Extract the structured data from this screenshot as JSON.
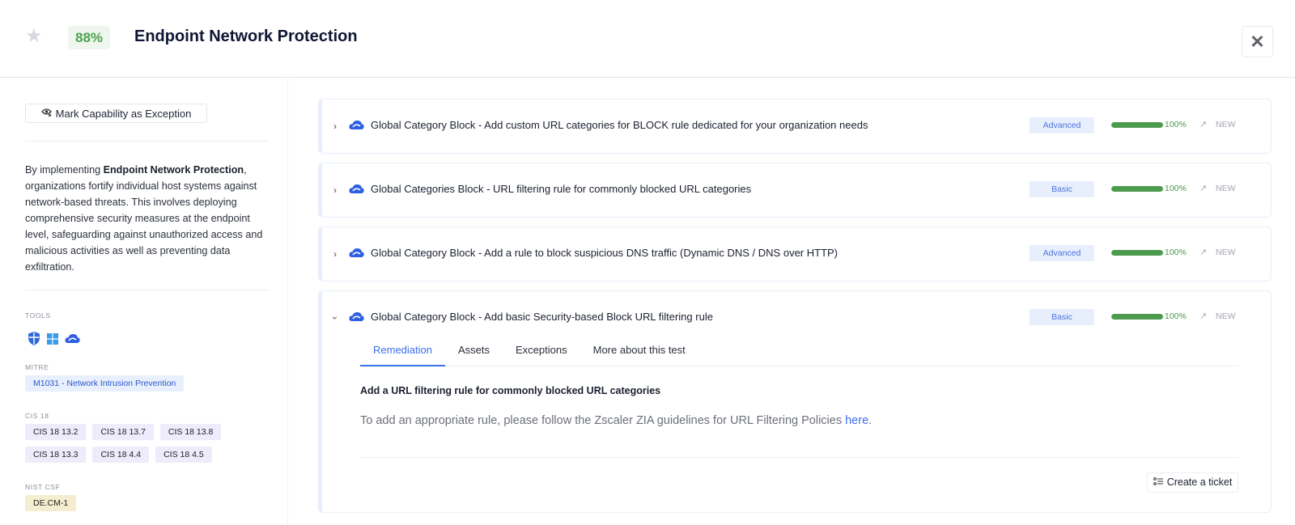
{
  "header": {
    "star_icon": "star-icon",
    "score": "88%",
    "title": "Endpoint Network Protection",
    "close_icon": "close-icon"
  },
  "left": {
    "exception_button": "Mark Capability as Exception",
    "description_prefix": "By implementing ",
    "description_bold": "Endpoint Network Protection",
    "description_suffix": ", organizations fortify individual host systems against network-based threats. This involves deploying comprehensive security measures at the endpoint level, safeguarding against unauthorized access and malicious activities as well as preventing data exfiltration.",
    "tools_label": "TOOLS",
    "tools": [
      "shield-defender-icon",
      "windows-icon",
      "zscaler-cloud-icon"
    ],
    "mitre_label": "MITRE",
    "mitre": [
      "M1031 - Network Intrusion Prevention"
    ],
    "cis_label": "CIS 18",
    "cis_rows": [
      [
        "CIS 18 13.2",
        "CIS 18 13.7",
        "CIS 18 13.8"
      ],
      [
        "CIS 18 13.3",
        "CIS 18 4.4",
        "CIS 18 4.5"
      ]
    ],
    "nist_label": "NIST CSF",
    "nist": [
      "DE.CM-1"
    ]
  },
  "cards": [
    {
      "title": "Global Category Block - Add custom URL categories for BLOCK rule dedicated for your organization needs",
      "level": "Advanced",
      "progress_pct": 100,
      "progress_label": "100%",
      "status": "NEW",
      "expanded": false
    },
    {
      "title": "Global Categories Block - URL filtering rule for commonly blocked URL categories",
      "level": "Basic",
      "progress_pct": 100,
      "progress_label": "100%",
      "status": "NEW",
      "expanded": false
    },
    {
      "title": "Global Category Block - Add a rule to block suspicious DNS traffic (Dynamic DNS / DNS over HTTP)",
      "level": "Advanced",
      "progress_pct": 100,
      "progress_label": "100%",
      "status": "NEW",
      "expanded": false
    },
    {
      "title": "Global Category Block - Add basic Security-based Block URL filtering rule",
      "level": "Basic",
      "progress_pct": 100,
      "progress_label": "100%",
      "status": "NEW",
      "expanded": true
    }
  ],
  "expanded": {
    "tabs": [
      "Remediation",
      "Assets",
      "Exceptions",
      "More about this test"
    ],
    "active_tab": "Remediation",
    "remediation_title": "Add a URL filtering rule for commonly blocked URL categories",
    "remediation_text": "To add an appropriate rule, please follow the Zscaler ZIA guidelines for URL Filtering Policies ",
    "remediation_link": "here",
    "remediation_end": ".",
    "ticket_button": "Create a ticket"
  },
  "colors": {
    "score_green": "#4ca24c",
    "accent_blue": "#3c6ff0",
    "progress_green": "#4c9a4c"
  }
}
